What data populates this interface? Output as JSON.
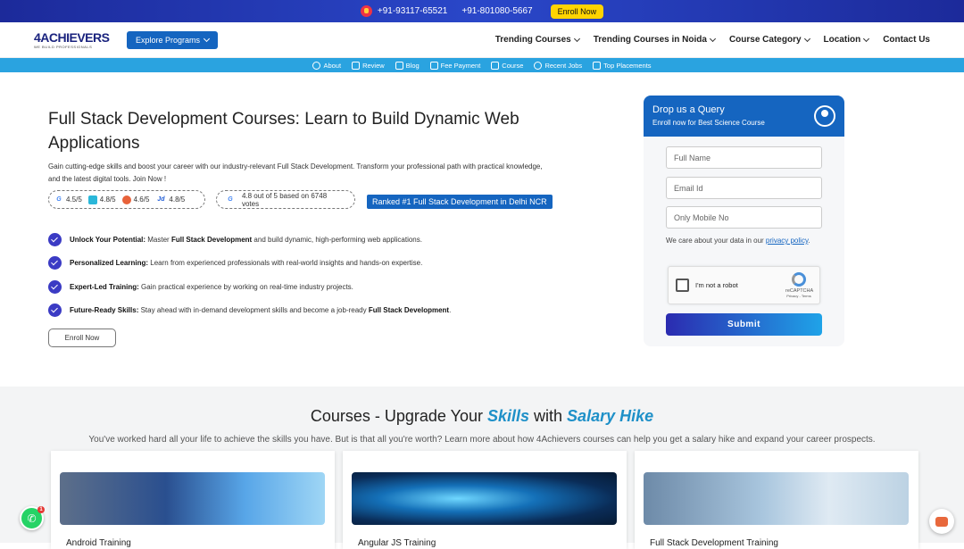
{
  "topbar": {
    "phone1": "+91-93117-65521",
    "phone2": "+91-801080-5667",
    "enroll": "Enroll Now"
  },
  "nav": {
    "logo_text": "4ACHIEVERS",
    "logo_tagline": "WE BUILD PROFESSIONALS",
    "explore": "Explore Programs",
    "menu": [
      "Trending Courses",
      "Trending Courses in Noida",
      "Course Category",
      "Location",
      "Contact Us"
    ]
  },
  "subnav": [
    "About",
    "Review",
    "Blog",
    "Fee Payment",
    "Course",
    "Recent Jobs",
    "Top Placements"
  ],
  "hero": {
    "title": "Full Stack Development Courses: Learn to Build Dynamic Web Applications",
    "description": "Gain cutting-edge skills and boost your career with our industry-relevant Full Stack Development. Transform your professional path with practical knowledge, and the latest digital tools. Join Now !",
    "ratings": [
      "4.5/5",
      "4.8/5",
      "4.6/5",
      "4.8/5"
    ],
    "google_votes": "4.8 out of 5 based on 6748 votes",
    "ranked": "Ranked #1 Full Stack Development in Delhi NCR",
    "bullets": [
      {
        "bold": "Unlock Your Potential:",
        "text": " Master ",
        "bold2": "Full Stack Development",
        "text2": " and build dynamic, high-performing web applications."
      },
      {
        "bold": "Personalized Learning:",
        "text": " Learn from experienced professionals with real-world insights and hands-on expertise.",
        "bold2": "",
        "text2": ""
      },
      {
        "bold": "Expert-Led Training:",
        "text": " Gain practical experience by working on real-time industry projects.",
        "bold2": "",
        "text2": ""
      },
      {
        "bold": "Future-Ready Skills:",
        "text": " Stay ahead with in-demand development skills and become a job-ready ",
        "bold2": "Full Stack Development",
        "text2": "."
      }
    ],
    "enroll": "Enroll Now"
  },
  "form": {
    "title": "Drop us a Query",
    "subtitle": "Enroll now for Best Science Course",
    "name_placeholder": "Full Name",
    "email_placeholder": "Email Id",
    "mobile_placeholder": "Only Mobile No",
    "care_text": "We care about your data in our ",
    "privacy": "privacy policy",
    "captcha_label": "I'm not a robot",
    "captcha_brand": "reCAPTCHA",
    "captcha_links": "Privacy - Terms",
    "submit": "Submit"
  },
  "courses": {
    "heading_pre": "Courses - Upgrade Your ",
    "heading_em1": "Skills",
    "heading_mid": " with ",
    "heading_em2": "Salary Hike",
    "subtitle": "You've worked hard all your life to achieve the skills you have. But is that all you're worth? Learn more about how 4Achievers courses can help you get a salary hike and expand your career prospects.",
    "cards": [
      "Android Training",
      "Angular JS Training",
      "Full Stack Development Training"
    ]
  },
  "colors": {
    "primary": "#1565c0",
    "accent": "#1e90c8",
    "topbar": "#2a47c9",
    "whatsapp": "#25d366"
  }
}
